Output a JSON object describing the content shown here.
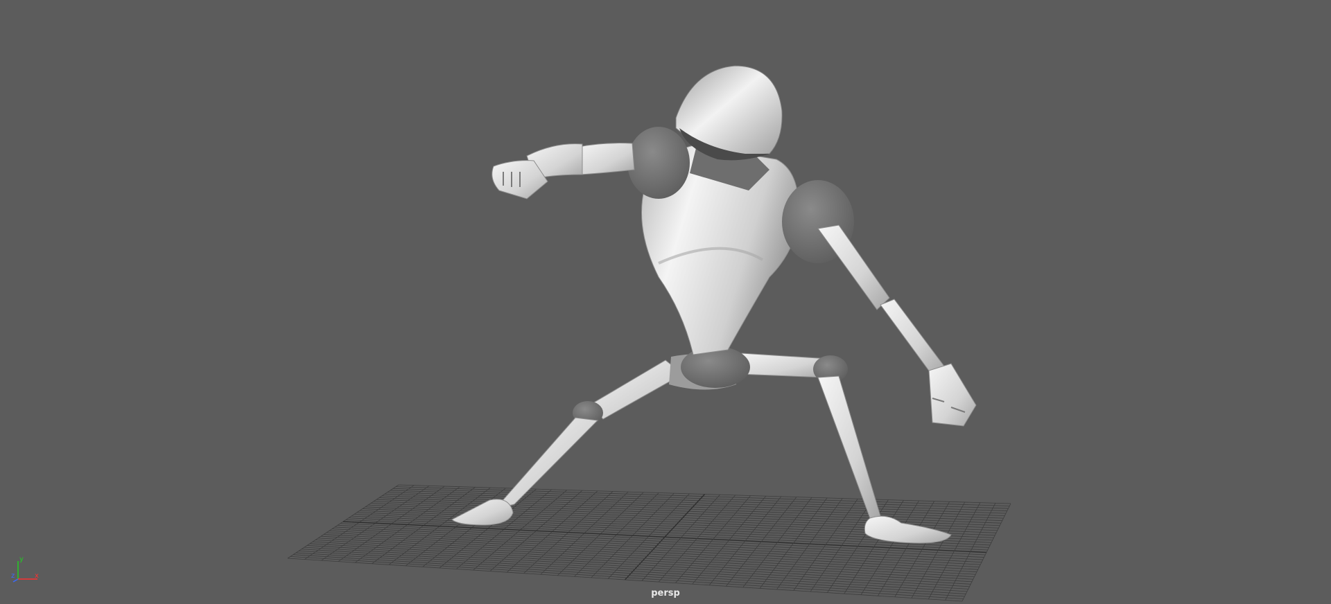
{
  "viewport": {
    "camera_label": "persp",
    "background_color": "#5c5c5c",
    "grid_color": "#3a3a3a"
  },
  "axis_gizmo": {
    "y_label": "y",
    "z_label": "z",
    "x_label": "x",
    "y_color": "#22cc22",
    "z_color": "#3a6bff",
    "x_color": "#ff3030"
  }
}
